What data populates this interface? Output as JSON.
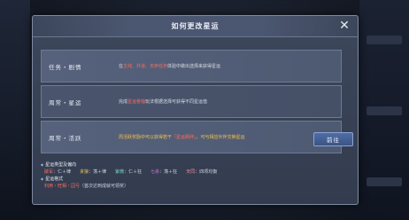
{
  "dialog": {
    "title": "如何更改星运",
    "close_symbol": "✕"
  },
  "rows": [
    {
      "label": "任务・剧情",
      "desc_pre": "在",
      "desc_hl": "主线、外道、天命任务",
      "desc_post": "体验中做出选择来获得星运"
    },
    {
      "label": "周常・星运",
      "desc_pre": "完成",
      "desc_hl": "星运卷轴",
      "desc_post": "玩法根据选择可获得不同星运值"
    },
    {
      "label": "周常・活跃",
      "desc_pre": "周活跃奖励中可以获得若干",
      "desc_hl": "「星运羁绊」",
      "desc_post": "，可与相应伙伴交换星运",
      "button": "前往"
    }
  ],
  "info": {
    "types_head": "星运类型及偏向",
    "types": [
      {
        "key": "破军",
        "value": "仁＋律"
      },
      {
        "key": "贪狼",
        "value": "荡＋律"
      },
      {
        "key": "紫微",
        "value": "仁＋狂"
      },
      {
        "key": "七杀",
        "value": "荡＋狂"
      },
      {
        "key": "天同",
        "value": "四项均衡"
      }
    ],
    "methods_head": "星运格式",
    "methods_key": "利用・旺相・囚亏",
    "methods_note": "（首次达到成就可领奖）"
  },
  "colors": {
    "dialog_bg": "#3a4458",
    "highlight_red": "#ff6b5e",
    "highlight_gold": "#f2c24d",
    "button_blue": "#4a659a"
  }
}
